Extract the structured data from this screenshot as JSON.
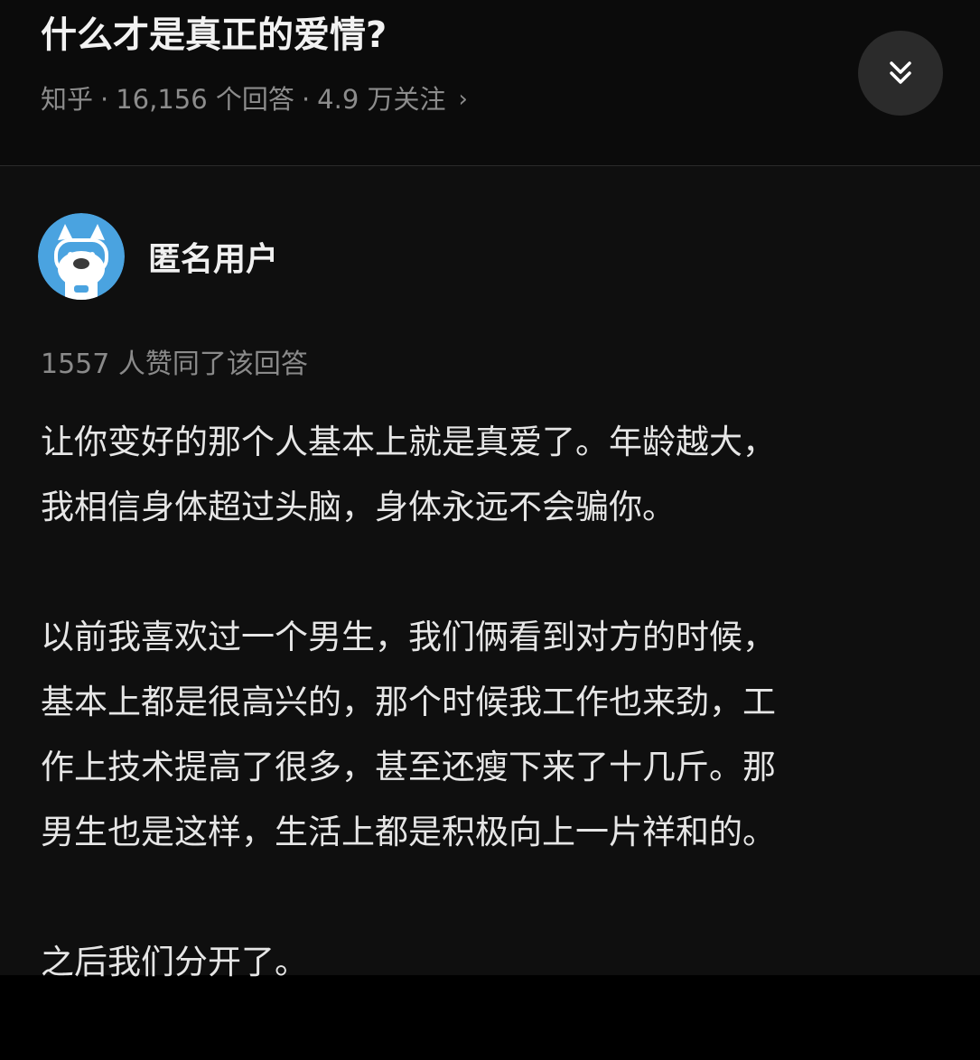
{
  "question": {
    "title": "什么才是真正的爱情?",
    "meta": {
      "source": "知乎",
      "separator": "·",
      "answers": "16,156 个回答",
      "followers": "4.9 万关注",
      "chevron": "›"
    },
    "collapse_icon": "double-chevron-down-icon"
  },
  "answer": {
    "author": "匿名用户",
    "avatar_icon": "anonymous-user-avatar-icon",
    "votes_text": "1557 人赞同了该回答",
    "paragraphs": [
      "让你变好的那个人基本上就是真爱了。年龄越大，\n我相信身体超过头脑，身体永远不会骗你。",
      "以前我喜欢过一个男生，我们俩看到对方的时候，\n基本上都是很高兴的，那个时候我工作也来劲，工\n作上技术提高了很多，甚至还瘦下来了十几斤。那\n男生也是这样，生活上都是积极向上一片祥和的。",
      "之后我们分开了。"
    ]
  },
  "colors": {
    "background": "#000000",
    "header_bg": "#0b0b0b",
    "content_bg": "#0f0f0f",
    "avatar_blue": "#4aa3e0"
  }
}
